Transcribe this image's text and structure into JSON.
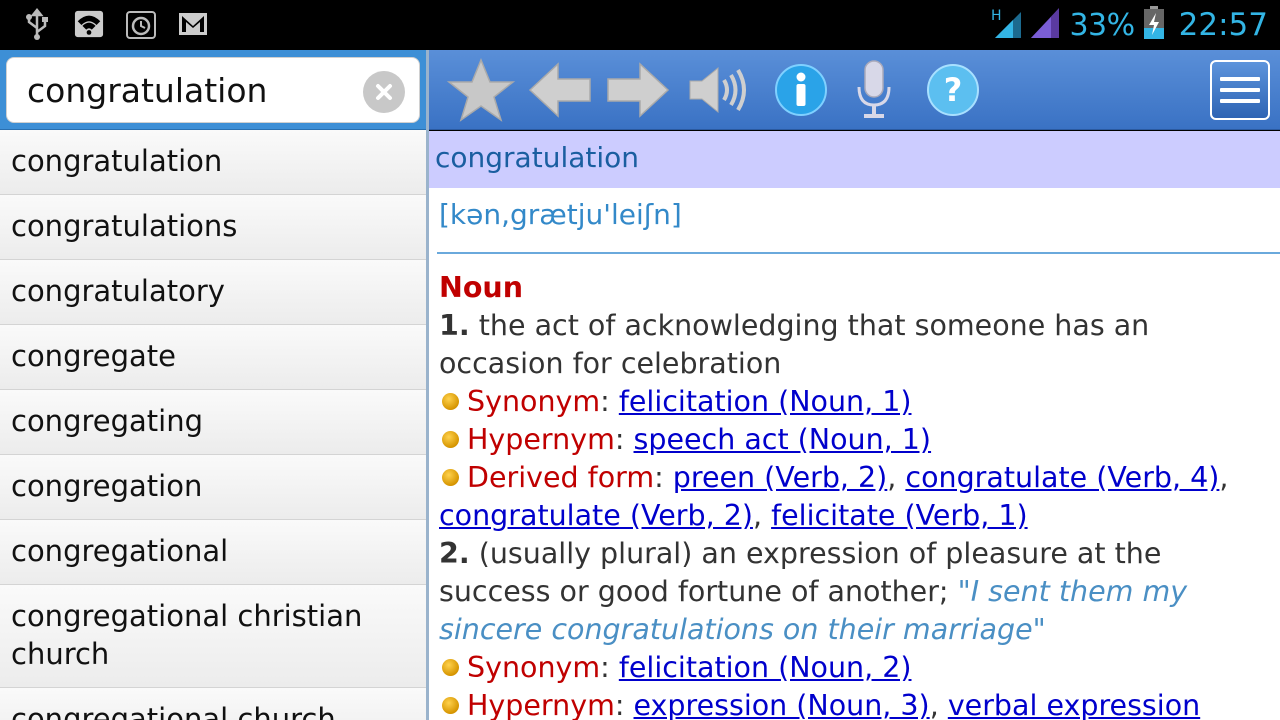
{
  "status_bar": {
    "battery_pct": "33%",
    "time": "22:57",
    "network_type": "H",
    "icons": [
      "usb-icon",
      "wifi-icon",
      "alarm-icon",
      "gmail-icon",
      "signal-icon",
      "battery-charging-icon"
    ]
  },
  "search": {
    "query": "congratulation",
    "clear_icon": "clear-icon"
  },
  "word_list": [
    "congratulation",
    "congratulations",
    "congratulatory",
    "congregate",
    "congregating",
    "congregation",
    "congregational",
    "congregational christian church",
    "congregational church"
  ],
  "toolbar": {
    "icons": [
      "star-icon",
      "back-arrow-icon",
      "forward-arrow-icon",
      "speaker-icon",
      "info-icon",
      "microphone-icon",
      "help-icon",
      "menu-icon"
    ]
  },
  "entry": {
    "headword": "congratulation",
    "pronunciation": "[kən,grætju'leiʃn]",
    "pos": "Noun",
    "sense1": {
      "num": "1.",
      "definition": "the act of acknowledging that someone has an occasion for celebration",
      "synonym_label": "Synonym",
      "synonyms": [
        "felicitation (Noun, 1)"
      ],
      "hypernym_label": "Hypernym",
      "hypernyms": [
        "speech act (Noun, 1)"
      ],
      "derived_label": "Derived form",
      "derived": [
        "preen (Verb, 2)",
        "congratulate (Verb, 4)",
        "congratulate (Verb, 2)",
        "felicitate (Verb, 1)"
      ]
    },
    "sense2": {
      "num": "2.",
      "definition": "(usually plural) an expression of pleasure at the success or good fortune of another;",
      "example": "\"I sent them my sincere congratulations on their marriage\"",
      "synonym_label": "Synonym",
      "synonyms": [
        "felicitation (Noun, 2)"
      ],
      "hypernym_label": "Hypernym",
      "hypernyms": [
        "expression (Noun, 3)",
        "verbal expression"
      ]
    }
  },
  "colors": {
    "accent": "#33b5e5",
    "toolbar": "#4a82cf",
    "headword_bg": "#ccccff",
    "pos_red": "#c00000",
    "link": "#0000cc"
  }
}
